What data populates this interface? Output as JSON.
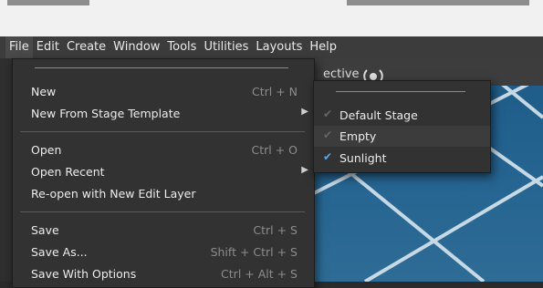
{
  "menubar": {
    "items": [
      "File",
      "Edit",
      "Create",
      "Window",
      "Tools",
      "Utilities",
      "Layouts",
      "Help"
    ]
  },
  "viewport": {
    "camera_label": "ective"
  },
  "file_menu": {
    "items": [
      {
        "label": "New",
        "shortcut": "Ctrl + N",
        "submenu": false
      },
      {
        "label": "New From Stage Template",
        "shortcut": "",
        "submenu": true
      },
      {
        "label": "Open",
        "shortcut": "Ctrl + O",
        "submenu": false
      },
      {
        "label": "Open Recent",
        "shortcut": "",
        "submenu": true
      },
      {
        "label": "Re-open with New Edit Layer",
        "shortcut": "",
        "submenu": false
      },
      {
        "label": "Save",
        "shortcut": "Ctrl + S",
        "submenu": false
      },
      {
        "label": "Save As...",
        "shortcut": "Shift + Ctrl + S",
        "submenu": false
      },
      {
        "label": "Save With Options",
        "shortcut": "Ctrl + Alt + S",
        "submenu": false
      }
    ]
  },
  "template_submenu": {
    "items": [
      {
        "label": "Default Stage",
        "checked": false
      },
      {
        "label": "Empty",
        "checked": false
      },
      {
        "label": "Sunlight",
        "checked": true
      }
    ]
  },
  "colors": {
    "menu_bg": "#323232",
    "menubar_bg": "#3c3c3c",
    "check_accent": "#5aa9e6",
    "viewport_blue": "#23628f"
  }
}
